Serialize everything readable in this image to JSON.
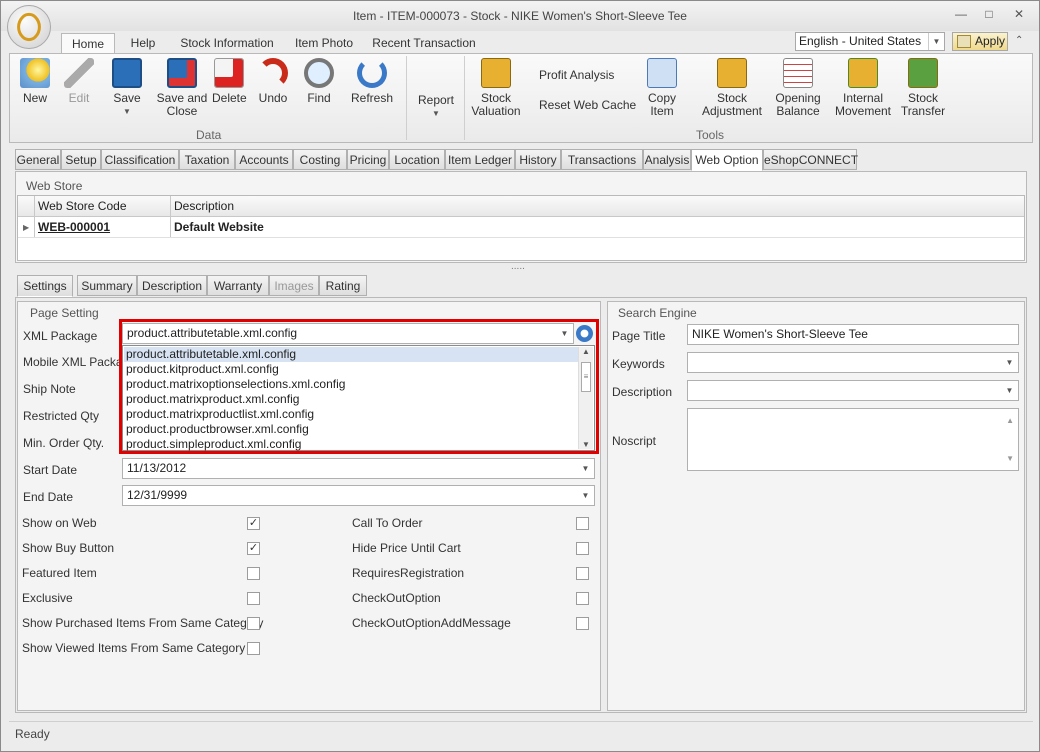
{
  "window": {
    "title": "Item - ITEM-000073 - Stock - NIKE Women's Short-Sleeve Tee"
  },
  "ribbon_tabs": [
    "Home",
    "Help",
    "Stock Information",
    "Item Photo",
    "Recent Transaction"
  ],
  "language": "English - United States",
  "apply_label": "Apply",
  "ribbon": {
    "new": "New",
    "edit": "Edit",
    "save": "Save",
    "save_close": "Save and\nClose",
    "delete": "Delete",
    "undo": "Undo",
    "find": "Find",
    "refresh": "Refresh",
    "data_group": "Data",
    "report": "Report",
    "stock_valuation": "Stock\nValuation",
    "profit_analysis": "Profit Analysis",
    "reset_web_cache": "Reset Web Cache",
    "copy_item": "Copy Item",
    "stock_adjustment": "Stock\nAdjustment",
    "opening_balance": "Opening\nBalance",
    "internal_movement": "Internal\nMovement",
    "stock_transfer": "Stock\nTransfer",
    "tools_group": "Tools"
  },
  "page_tabs": [
    "General",
    "Setup",
    "Classification",
    "Taxation",
    "Accounts",
    "Costing",
    "Pricing",
    "Location",
    "Item Ledger",
    "History",
    "Transactions",
    "Analysis",
    "Web Option",
    "eShopCONNECT"
  ],
  "webstore": {
    "title": "Web Store",
    "col_code": "Web Store Code",
    "col_desc": "Description",
    "row_code": "WEB-000001",
    "row_desc": "Default Website",
    "splitter": "....."
  },
  "sub_tabs": [
    "Settings",
    "Summary",
    "Description",
    "Warranty",
    "Images",
    "Rating"
  ],
  "page_setting": {
    "title": "Page Setting",
    "xml_package_label": "XML Package",
    "xml_package_value": "product.attributetable.xml.config",
    "mobile_xml_label": "Mobile XML Package",
    "ship_note_label": "Ship Note",
    "restricted_qty_label": "Restricted Qty",
    "min_order_label": "Min. Order Qty.",
    "start_date_label": "Start Date",
    "start_date": "11/13/2012",
    "end_date_label": "End Date",
    "end_date": "12/31/9999",
    "dropdown_items": [
      "product.attributetable.xml.config",
      "product.kitproduct.xml.config",
      "product.matrixoptionselections.xml.config",
      "product.matrixproduct.xml.config",
      "product.matrixproductlist.xml.config",
      "product.productbrowser.xml.config",
      "product.simpleproduct.xml.config"
    ],
    "left_checks": [
      "Show on Web",
      "Show Buy Button",
      "Featured Item",
      "Exclusive",
      "Show Purchased Items From Same Category",
      "Show Viewed Items From Same Category"
    ],
    "right_checks": [
      "Call To Order",
      "Hide Price Until Cart",
      "RequiresRegistration",
      "CheckOutOption",
      "CheckOutOptionAddMessage"
    ],
    "left_checked": [
      true,
      true,
      false,
      false,
      false,
      false
    ],
    "right_checked": [
      false,
      false,
      false,
      false,
      false
    ]
  },
  "search_engine": {
    "title": "Search Engine",
    "page_title_label": "Page Title",
    "page_title": "NIKE Women's Short-Sleeve Tee",
    "keywords_label": "Keywords",
    "description_label": "Description",
    "noscript_label": "Noscript"
  },
  "status": "Ready"
}
